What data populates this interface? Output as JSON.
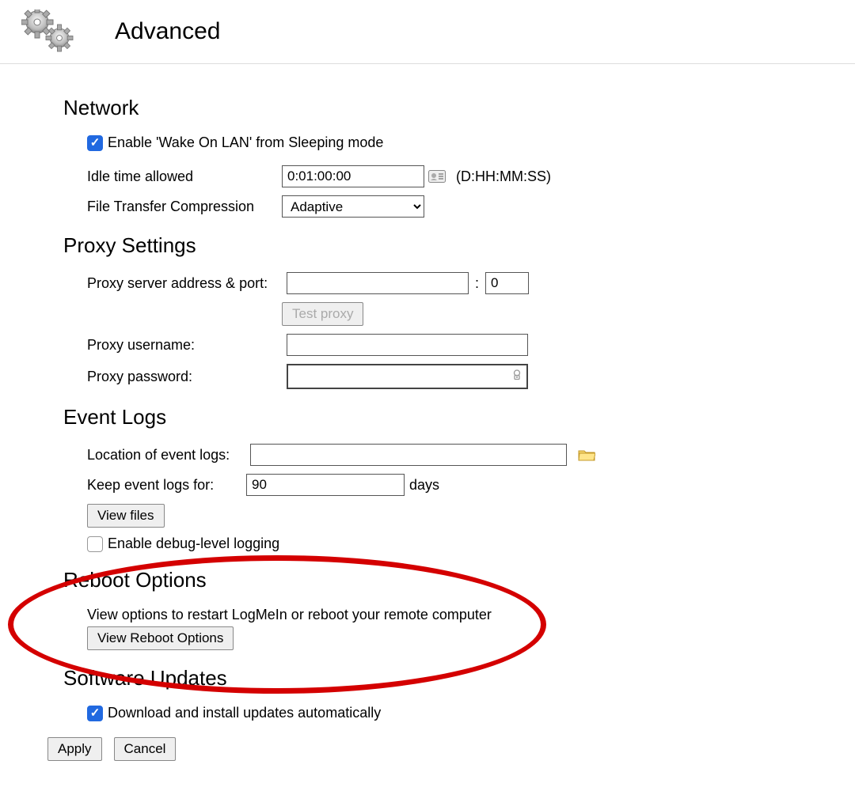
{
  "page_title": "Advanced",
  "sections": {
    "network": {
      "heading": "Network",
      "enable_wol_label": "Enable 'Wake On LAN' from Sleeping mode",
      "enable_wol_checked": true,
      "idle_label": "Idle time allowed",
      "idle_value": "0:01:00:00",
      "idle_hint": "(D:HH:MM:SS)",
      "compression_label": "File Transfer Compression",
      "compression_value": "Adaptive"
    },
    "proxy": {
      "heading": "Proxy Settings",
      "address_label": "Proxy server address & port:",
      "address_value": "",
      "port_value": "0",
      "test_button": "Test proxy",
      "username_label": "Proxy username:",
      "username_value": "",
      "password_label": "Proxy password:",
      "password_value": ""
    },
    "eventlogs": {
      "heading": "Event Logs",
      "location_label": "Location of event logs:",
      "location_value": "",
      "keep_label": "Keep event logs for:",
      "keep_value": "90",
      "keep_unit": "days",
      "view_files_button": "View files",
      "debug_label": "Enable debug-level logging",
      "debug_checked": false
    },
    "reboot": {
      "heading": "Reboot Options",
      "description": "View options to restart LogMeIn or reboot your remote computer",
      "button": "View Reboot Options"
    },
    "updates": {
      "heading": "Software Updates",
      "auto_label": "Download and install updates automatically",
      "auto_checked": true
    }
  },
  "footer": {
    "apply": "Apply",
    "cancel": "Cancel"
  }
}
